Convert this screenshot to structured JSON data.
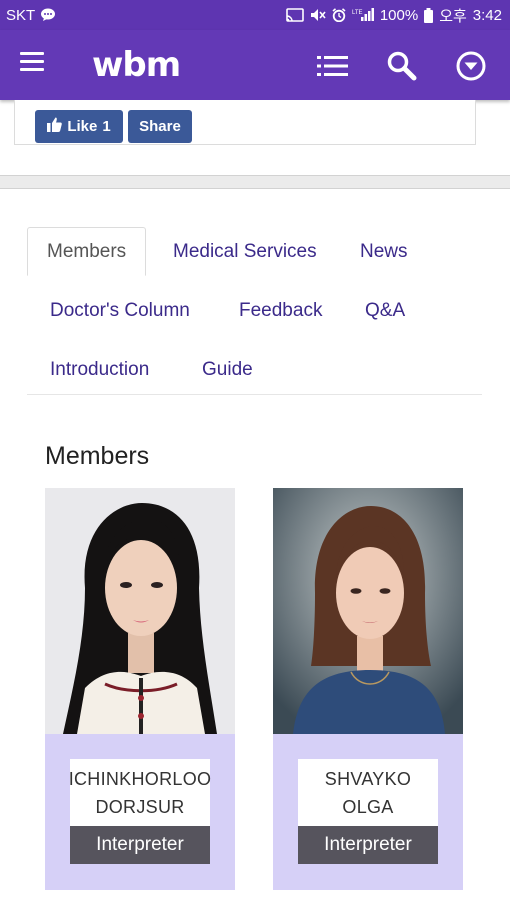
{
  "status_bar": {
    "carrier": "SKT",
    "battery": "100%",
    "ampm": "오후",
    "time": "3:42",
    "network": "LTE"
  },
  "app_bar": {
    "logo": "wbm",
    "icons": [
      "menu-icon",
      "list-icon",
      "search-icon",
      "dropdown-circle-icon"
    ],
    "color": "#6339b6"
  },
  "social": {
    "like_label": "Like",
    "like_count": "1",
    "share_label": "Share",
    "color": "#3b5998"
  },
  "tabs": [
    {
      "label": "Members",
      "active": true
    },
    {
      "label": "Medical Services",
      "active": false
    },
    {
      "label": "News",
      "active": false
    },
    {
      "label": "Doctor's Column",
      "active": false
    },
    {
      "label": "Feedback",
      "active": false
    },
    {
      "label": "Q&A",
      "active": false
    },
    {
      "label": "Introduction",
      "active": false
    },
    {
      "label": "Guide",
      "active": false
    }
  ],
  "section": {
    "title": "Members"
  },
  "members": [
    {
      "name_line1": "ICHINKHORLOO",
      "name_line2": "DORJSUR",
      "role": "Interpreter"
    },
    {
      "name_line1": "SHVAYKO",
      "name_line2": "OLGA",
      "role": "Interpreter"
    }
  ],
  "colors": {
    "card_bg": "#d6d0f7",
    "badge_bg": "#56545d",
    "tab_text": "#3b2a8a"
  }
}
